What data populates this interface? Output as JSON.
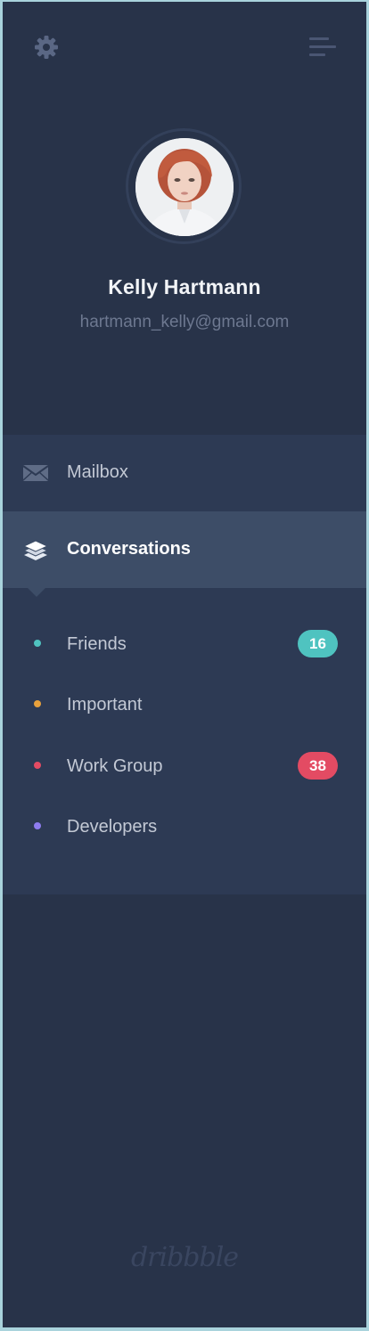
{
  "header": {
    "settings_icon": "gear-icon",
    "menu_icon": "menu-lines-icon"
  },
  "profile": {
    "name": "Kelly Hartmann",
    "email": "hartmann_kelly@gmail.com"
  },
  "nav": {
    "items": [
      {
        "label": "Mailbox",
        "icon": "envelope-icon",
        "active": false
      },
      {
        "label": "Conversations",
        "icon": "layers-icon",
        "active": true
      }
    ],
    "sub_items": [
      {
        "label": "Friends",
        "dot_color": "#4fc3c0",
        "badge": "16",
        "badge_color": "#4fc3c0"
      },
      {
        "label": "Important",
        "dot_color": "#e8a13c",
        "badge": null,
        "badge_color": null
      },
      {
        "label": "Work Group",
        "dot_color": "#e34b63",
        "badge": "38",
        "badge_color": "#e34b63"
      },
      {
        "label": "Developers",
        "dot_color": "#8e7cf0",
        "badge": null,
        "badge_color": null
      }
    ]
  },
  "footer": {
    "logo": "dribbble"
  },
  "colors": {
    "panel_bg": "#283349",
    "nav_bg": "#2d3a54",
    "active_bg": "#3d4d67",
    "border": "#a9d3dc"
  }
}
